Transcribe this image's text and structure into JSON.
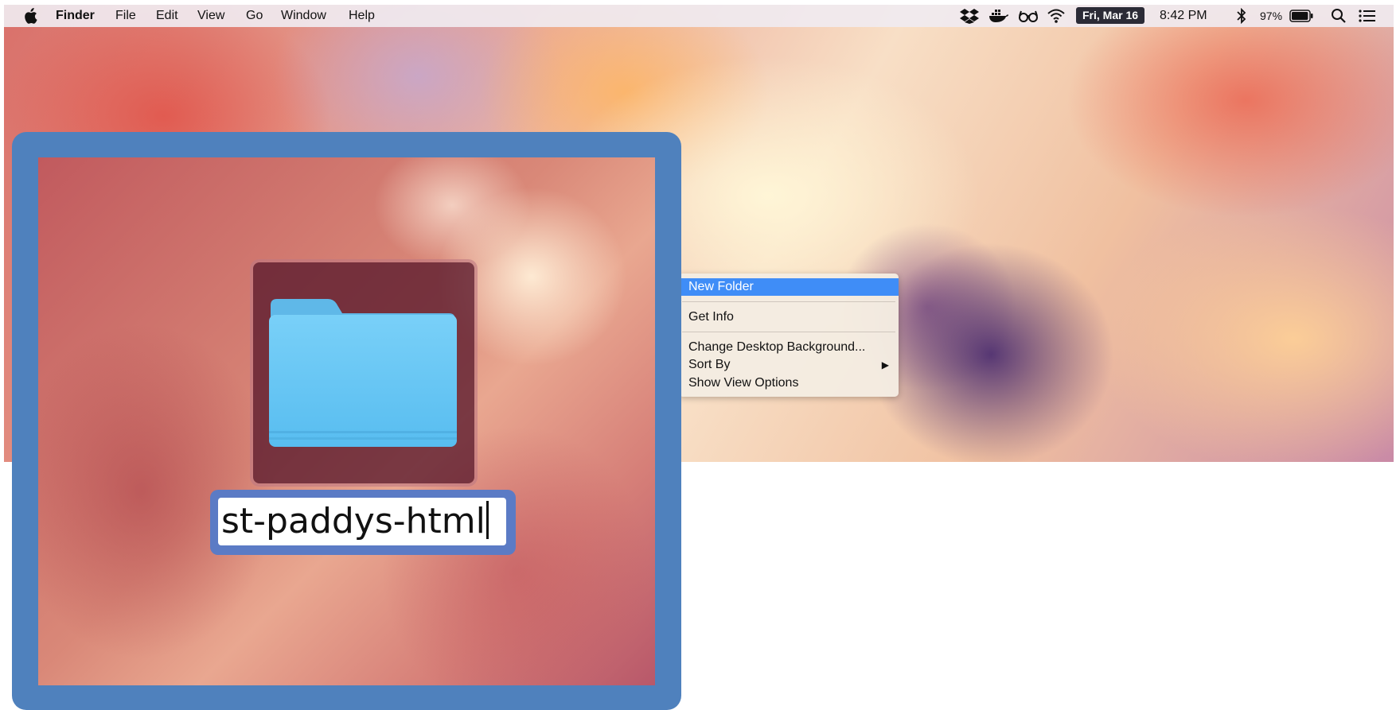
{
  "menubar": {
    "apple_icon": "apple-icon",
    "app_name": "Finder",
    "menus": [
      "File",
      "Edit",
      "View",
      "Go",
      "Window",
      "Help"
    ],
    "status_icons": [
      "dropbox-icon",
      "docker-icon",
      "glasses-icon",
      "wifi-icon"
    ],
    "date": "Fri, Mar 16",
    "time": "8:42 PM",
    "battery_percent": "97%",
    "battery_level": 0.97,
    "extra_icons": [
      "bluetooth-icon",
      "battery-icon",
      "spotlight-search-icon",
      "notification-center-icon"
    ]
  },
  "context_menu": {
    "items": [
      {
        "label": "New Folder",
        "selected": true
      },
      {
        "label": "Get Info"
      },
      {
        "label": "Change Desktop Background..."
      },
      {
        "label": "Sort By",
        "submenu": true
      },
      {
        "label": "Show View Options"
      }
    ],
    "submenu_arrow": "▶"
  },
  "zoom_callout": {
    "folder_icon": "folder-icon",
    "folder_name": "st-paddys-html",
    "accent_color": "#4f81bd"
  },
  "colors": {
    "selection": "#3f8df7",
    "date_badge": "#2b2b36",
    "callout_border": "#4f81bd"
  }
}
